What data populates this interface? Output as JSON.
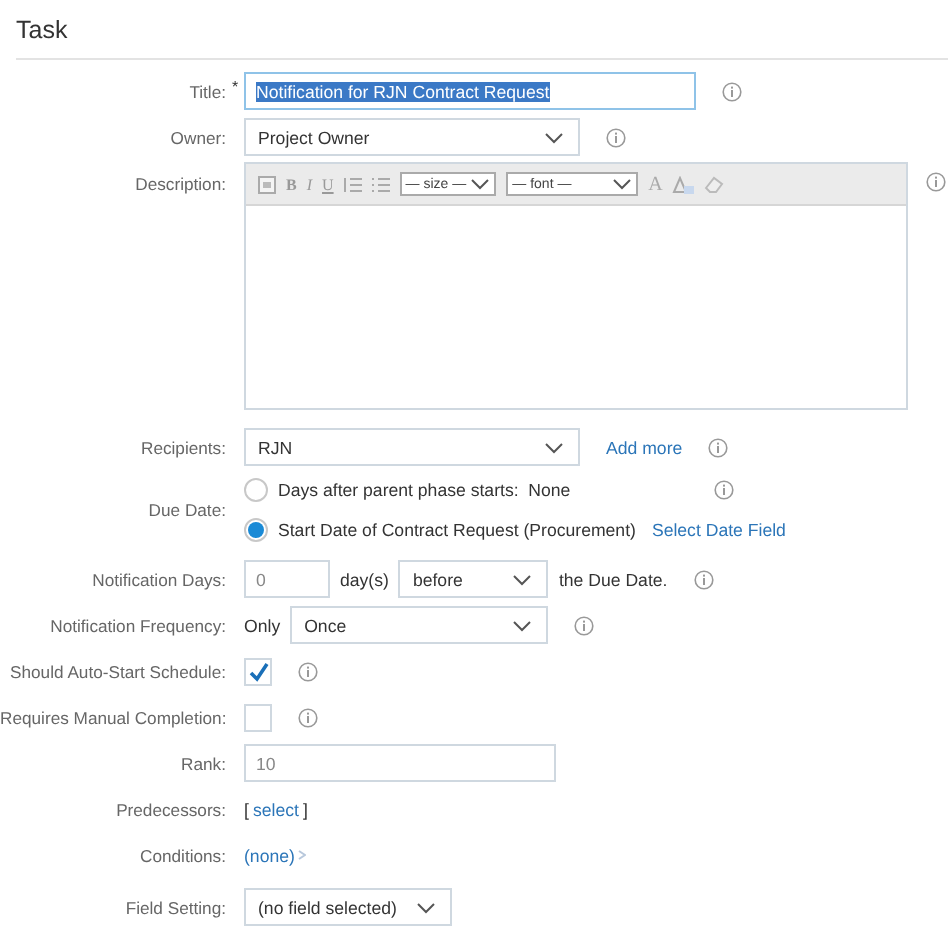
{
  "header": {
    "title": "Task"
  },
  "rows": [
    {
      "kind": "text",
      "label": "Title:",
      "required_mark": "*",
      "value": "Notification for RJN Contract Request",
      "highlighted": true,
      "info": true
    },
    {
      "kind": "select",
      "label": "Owner:",
      "value": "Project Owner",
      "info": true
    },
    {
      "kind": "editor",
      "label": "Description:",
      "info": true,
      "toolbar": [
        {
          "kind": "source"
        },
        {
          "kind": "bold",
          "text": "B"
        },
        {
          "kind": "italic",
          "text": "I"
        },
        {
          "kind": "underline",
          "text": "U"
        },
        {
          "kind": "ordered-list"
        },
        {
          "kind": "bullet-list"
        },
        {
          "kind": "select",
          "text": "— size —"
        },
        {
          "kind": "select",
          "text": "— font —"
        },
        {
          "kind": "text-color",
          "text": "A"
        },
        {
          "kind": "highlight"
        },
        {
          "kind": "eraser"
        }
      ]
    },
    {
      "kind": "select",
      "label": "Recipients:",
      "value": "RJN",
      "link": "Add more",
      "info": true
    },
    {
      "kind": "radios",
      "label": "Due Date:",
      "info": true,
      "options": [
        {
          "text": "Days after parent phase starts:  None",
          "selected": false
        },
        {
          "text": "Start Date of Contract Request (Procurement)",
          "link": "Select Date Field",
          "selected": true
        }
      ]
    },
    {
      "kind": "days",
      "label": "Notification Days:",
      "value": "0",
      "unit": "day(s)",
      "when": "before",
      "suffix": "the Due Date.",
      "info": true
    },
    {
      "kind": "frequency",
      "label": "Notification Frequency:",
      "prefix": "Only",
      "value": "Once",
      "info": true
    },
    {
      "kind": "checkbox",
      "label": "Should Auto-Start Schedule:",
      "checked": true,
      "info": true
    },
    {
      "kind": "checkbox",
      "label": "Requires Manual Completion:",
      "checked": false,
      "info": true
    },
    {
      "kind": "text",
      "label": "Rank:",
      "value": "10",
      "highlighted": false
    },
    {
      "kind": "bracket-link",
      "label": "Predecessors:",
      "open": "[",
      "link": "select",
      "close": "]"
    },
    {
      "kind": "link",
      "label": "Conditions:",
      "link": "(none)"
    },
    {
      "kind": "select",
      "label": "Field Setting:",
      "value": "(no field selected)"
    }
  ]
}
